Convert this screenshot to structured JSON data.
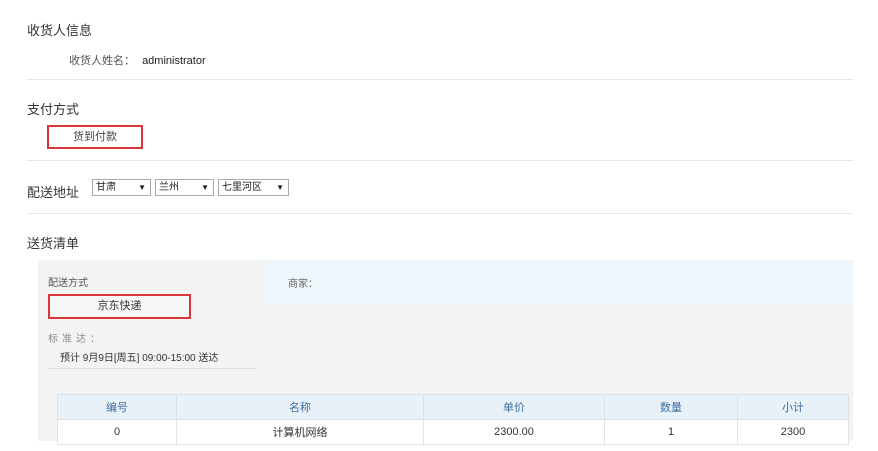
{
  "receiver": {
    "section_title": "收货人信息",
    "name_label": "收货人姓名：",
    "name_value": "administrator"
  },
  "payment": {
    "section_title": "支付方式",
    "method": "货到付款"
  },
  "address": {
    "label": "配送地址",
    "province": "甘肃",
    "city": "兰州",
    "district": "七里河区"
  },
  "delivery": {
    "section_title": "送货清单",
    "method_label": "配送方式",
    "method_value": "京东快递",
    "standard_label": "标准达：",
    "eta": "预计 9月9日[周五] 09:00-15:00 送达",
    "merchant_label": "商家："
  },
  "items_table": {
    "headers": [
      "编号",
      "名称",
      "单价",
      "数量",
      "小计"
    ],
    "rows": [
      [
        "0",
        "计算机网络",
        "2300.00",
        "1",
        "2300"
      ]
    ]
  },
  "icons": {
    "dropdown": "▼"
  },
  "colors": {
    "highlight_border": "#d9363a",
    "header_text": "#3d6fa3"
  }
}
